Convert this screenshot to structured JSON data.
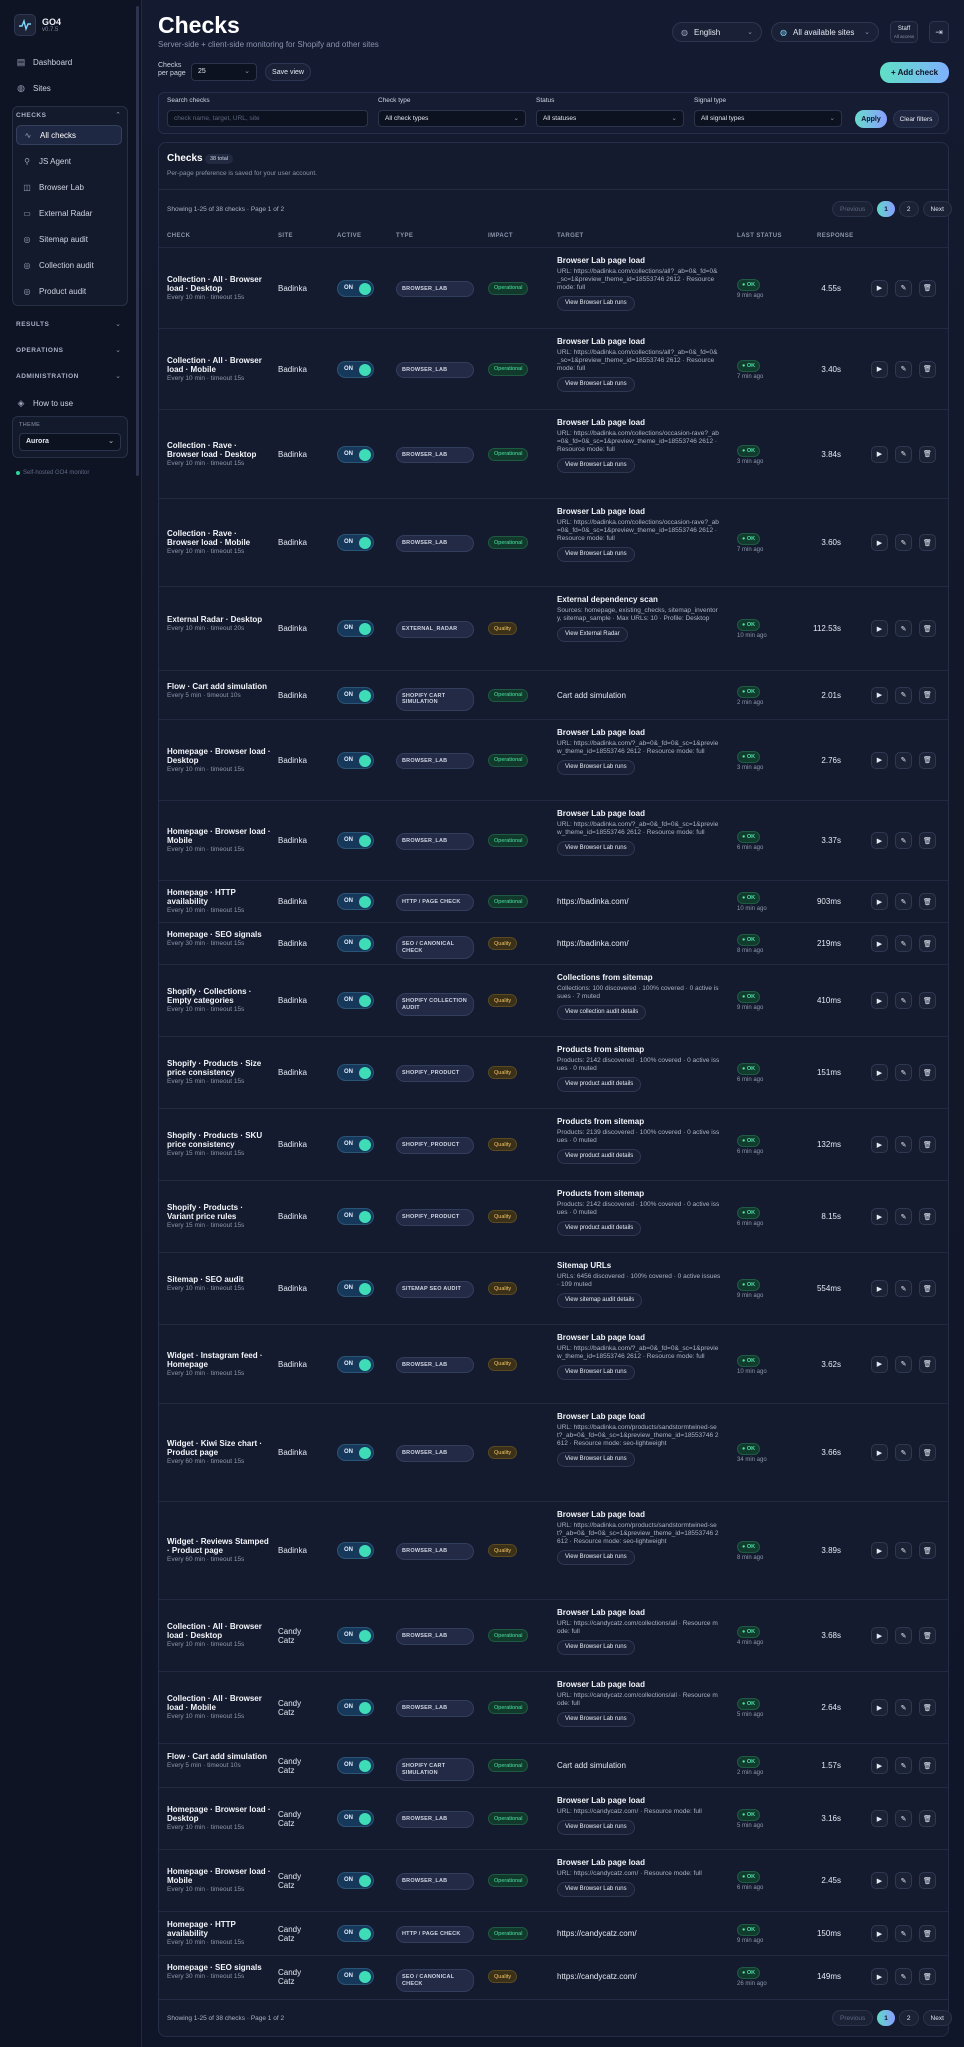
{
  "app": {
    "name": "GO4",
    "version": "v0.7.5"
  },
  "sidebar": {
    "top_items": [
      {
        "label": "Dashboard",
        "icon": "dashboard-icon"
      },
      {
        "label": "Sites",
        "icon": "globe-icon"
      }
    ],
    "checks_group": "CHECKS",
    "checks_items": [
      {
        "label": "All checks",
        "icon": "pulse-icon",
        "active": true
      },
      {
        "label": "JS Agent",
        "icon": "agent-icon"
      },
      {
        "label": "Browser Lab",
        "icon": "browser-icon"
      },
      {
        "label": "External Radar",
        "icon": "radar-icon"
      },
      {
        "label": "Sitemap audit",
        "icon": "sitemap-icon"
      },
      {
        "label": "Collection audit",
        "icon": "collection-icon"
      },
      {
        "label": "Product audit",
        "icon": "product-icon"
      }
    ],
    "groups": [
      "RESULTS",
      "OPERATIONS",
      "ADMINISTRATION"
    ],
    "how_to_use": "How to use",
    "theme_label": "THEME",
    "theme_value": "Aurora",
    "footer": "Self-hosted GO4 monitor"
  },
  "header": {
    "title": "Checks",
    "subtitle": "Server-side + client-side monitoring for Shopify and other sites",
    "language": "English",
    "sites_filter": "All available sites",
    "staff_label": "Staff",
    "staff_sub": "All access"
  },
  "toolbar": {
    "per_page_label": "Checks per page",
    "per_page_value": "25",
    "save_view": "Save view",
    "add_check": "+ Add check"
  },
  "filters": {
    "search_label": "Search checks",
    "search_placeholder": "check name, target, URL, site",
    "type_label": "Check type",
    "type_value": "All check types",
    "status_label": "Status",
    "status_value": "All statuses",
    "signal_label": "Signal type",
    "signal_value": "All signal types",
    "apply": "Apply",
    "clear": "Clear filters"
  },
  "list": {
    "title": "Checks",
    "total_badge": "38 total",
    "note": "Per-page preference is saved for your user account.",
    "showing": "Showing 1-25 of 38 checks · Page 1 of 2",
    "pager": {
      "previous": "Previous",
      "p1": "1",
      "p2": "2",
      "next": "Next"
    },
    "columns": [
      "CHECK",
      "SITE",
      "ACTIVE",
      "TYPE",
      "IMPACT",
      "TARGET",
      "LAST STATUS",
      "RESPONSE"
    ],
    "rows": [
      {
        "name": "Collection · All · Browser load · Desktop",
        "sched": "Every 10 min · timeout 15s",
        "site": "Badinka",
        "active": "ON",
        "type": "BROWSER_LAB",
        "impact": "Operational",
        "target_title": "Browser Lab page load",
        "target_detail": "URL: https://badinka.com/collections/all?_ab=0&_fd=0&_sc=1&preview_theme_id=18553746 2612 · Resource mode: full",
        "target_btn": "View Browser Lab runs",
        "status": "OK",
        "ago": "9 min ago",
        "resp": "4.55s"
      },
      {
        "name": "Collection · All · Browser load · Mobile",
        "sched": "Every 10 min · timeout 15s",
        "site": "Badinka",
        "active": "ON",
        "type": "BROWSER_LAB",
        "impact": "Operational",
        "target_title": "Browser Lab page load",
        "target_detail": "URL: https://badinka.com/collections/all?_ab=0&_fd=0&_sc=1&preview_theme_id=18553746 2612 · Resource mode: full",
        "target_btn": "View Browser Lab runs",
        "status": "OK",
        "ago": "7 min ago",
        "resp": "3.40s"
      },
      {
        "name": "Collection · Rave · Browser load · Desktop",
        "sched": "Every 10 min · timeout 15s",
        "site": "Badinka",
        "active": "ON",
        "type": "BROWSER_LAB",
        "impact": "Operational",
        "target_title": "Browser Lab page load",
        "target_detail": "URL: https://badinka.com/collections/occasion-rave?_ab=0&_fd=0&_sc=1&preview_theme_id=18553746 2612 · Resource mode: full",
        "target_btn": "View Browser Lab runs",
        "status": "OK",
        "ago": "3 min ago",
        "resp": "3.84s"
      },
      {
        "name": "Collection · Rave · Browser load · Mobile",
        "sched": "Every 10 min · timeout 15s",
        "site": "Badinka",
        "active": "ON",
        "type": "BROWSER_LAB",
        "impact": "Operational",
        "target_title": "Browser Lab page load",
        "target_detail": "URL: https://badinka.com/collections/occasion-rave?_ab=0&_fd=0&_sc=1&preview_theme_id=18553746 2612 · Resource mode: full",
        "target_btn": "View Browser Lab runs",
        "status": "OK",
        "ago": "7 min ago",
        "resp": "3.60s"
      },
      {
        "name": "External Radar · Desktop",
        "sched": "Every 10 min · timeout 20s",
        "site": "Badinka",
        "active": "ON",
        "type": "EXTERNAL_RADAR",
        "impact": "Quality",
        "target_title": "External dependency scan",
        "target_detail": "Sources: homepage, existing_checks, sitemap_inventory, sitemap_sample · Max URLs: 10 · Profile: Desktop",
        "target_btn": "View External Radar",
        "status": "OK",
        "ago": "10 min ago",
        "resp": "112.53s"
      },
      {
        "name": "Flow · Cart add simulation",
        "sched": "Every 5 min · timeout 10s",
        "site": "Badinka",
        "active": "ON",
        "type": "SHOPIFY CART SIMULATION",
        "impact": "Operational",
        "target_plain": "Cart add simulation",
        "status": "OK",
        "ago": "2 min ago",
        "resp": "2.01s"
      },
      {
        "name": "Homepage · Browser load · Desktop",
        "sched": "Every 10 min · timeout 15s",
        "site": "Badinka",
        "active": "ON",
        "type": "BROWSER_LAB",
        "impact": "Operational",
        "target_title": "Browser Lab page load",
        "target_detail": "URL: https://badinka.com/?_ab=0&_fd=0&_sc=1&preview_theme_id=18553746 2612 · Resource mode: full",
        "target_btn": "View Browser Lab runs",
        "status": "OK",
        "ago": "3 min ago",
        "resp": "2.76s"
      },
      {
        "name": "Homepage · Browser load · Mobile",
        "sched": "Every 10 min · timeout 15s",
        "site": "Badinka",
        "active": "ON",
        "type": "BROWSER_LAB",
        "impact": "Operational",
        "target_title": "Browser Lab page load",
        "target_detail": "URL: https://badinka.com/?_ab=0&_fd=0&_sc=1&preview_theme_id=18553746 2612 · Resource mode: full",
        "target_btn": "View Browser Lab runs",
        "status": "OK",
        "ago": "6 min ago",
        "resp": "3.37s"
      },
      {
        "name": "Homepage · HTTP availability",
        "sched": "Every 10 min · timeout 15s",
        "site": "Badinka",
        "active": "ON",
        "type": "HTTP / PAGE CHECK",
        "impact": "Operational",
        "target_plain": "https://badinka.com/",
        "status": "OK",
        "ago": "10 min ago",
        "resp": "903ms"
      },
      {
        "name": "Homepage · SEO signals",
        "sched": "Every 30 min · timeout 15s",
        "site": "Badinka",
        "active": "ON",
        "type": "SEO / CANONICAL CHECK",
        "impact": "Quality",
        "target_plain": "https://badinka.com/",
        "status": "OK",
        "ago": "8 min ago",
        "resp": "219ms"
      },
      {
        "name": "Shopify · Collections · Empty categories",
        "sched": "Every 10 min · timeout 15s",
        "site": "Badinka",
        "active": "ON",
        "type": "SHOPIFY COLLECTION AUDIT",
        "impact": "Quality",
        "target_title": "Collections from sitemap",
        "target_detail": "Collections: 100 discovered · 100% covered · 0 active issues · 7 muted",
        "target_btn": "View collection audit details",
        "status": "OK",
        "ago": "9 min ago",
        "resp": "410ms"
      },
      {
        "name": "Shopify · Products · Size price consistency",
        "sched": "Every 15 min · timeout 15s",
        "site": "Badinka",
        "active": "ON",
        "type": "SHOPIFY_PRODUCT",
        "impact": "Quality",
        "target_title": "Products from sitemap",
        "target_detail": "Products: 2142 discovered · 100% covered · 0 active issues · 0 muted",
        "target_btn": "View product audit details",
        "status": "OK",
        "ago": "6 min ago",
        "resp": "151ms"
      },
      {
        "name": "Shopify · Products · SKU price consistency",
        "sched": "Every 15 min · timeout 15s",
        "site": "Badinka",
        "active": "ON",
        "type": "SHOPIFY_PRODUCT",
        "impact": "Quality",
        "target_title": "Products from sitemap",
        "target_detail": "Products: 2139 discovered · 100% covered · 0 active issues · 0 muted",
        "target_btn": "View product audit details",
        "status": "OK",
        "ago": "6 min ago",
        "resp": "132ms"
      },
      {
        "name": "Shopify · Products · Variant price rules",
        "sched": "Every 15 min · timeout 15s",
        "site": "Badinka",
        "active": "ON",
        "type": "SHOPIFY_PRODUCT",
        "impact": "Quality",
        "target_title": "Products from sitemap",
        "target_detail": "Products: 2142 discovered · 100% covered · 0 active issues · 0 muted",
        "target_btn": "View product audit details",
        "status": "OK",
        "ago": "6 min ago",
        "resp": "8.15s"
      },
      {
        "name": "Sitemap · SEO audit",
        "sched": "Every 10 min · timeout 15s",
        "site": "Badinka",
        "active": "ON",
        "type": "SITEMAP SEO AUDIT",
        "impact": "Quality",
        "target_title": "Sitemap URLs",
        "target_detail": "URLs: 6456 discovered · 100% covered · 0 active issues · 109 muted",
        "target_btn": "View sitemap audit details",
        "status": "OK",
        "ago": "9 min ago",
        "resp": "554ms"
      },
      {
        "name": "Widget · Instagram feed · Homepage",
        "sched": "Every 10 min · timeout 15s",
        "site": "Badinka",
        "active": "ON",
        "type": "BROWSER_LAB",
        "impact": "Quality",
        "target_title": "Browser Lab page load",
        "target_detail": "URL: https://badinka.com/?_ab=0&_fd=0&_sc=1&preview_theme_id=18553746 2612 · Resource mode: full",
        "target_btn": "View Browser Lab runs",
        "status": "OK",
        "ago": "10 min ago",
        "resp": "3.62s"
      },
      {
        "name": "Widget · Kiwi Size chart · Product page",
        "sched": "Every 60 min · timeout 15s",
        "site": "Badinka",
        "active": "ON",
        "type": "BROWSER_LAB",
        "impact": "Quality",
        "target_title": "Browser Lab page load",
        "target_detail": "URL: https://badinka.com/products/sandstormtwined-set?_ab=0&_fd=0&_sc=1&preview_theme_id=18553746 2612 · Resource mode: seo-lightweight",
        "target_btn": "View Browser Lab runs",
        "status": "OK",
        "ago": "34 min ago",
        "resp": "3.66s"
      },
      {
        "name": "Widget · Reviews Stamped · Product page",
        "sched": "Every 60 min · timeout 15s",
        "site": "Badinka",
        "active": "ON",
        "type": "BROWSER_LAB",
        "impact": "Quality",
        "target_title": "Browser Lab page load",
        "target_detail": "URL: https://badinka.com/products/sandstormtwined-set?_ab=0&_fd=0&_sc=1&preview_theme_id=18553746 2612 · Resource mode: seo-lightweight",
        "target_btn": "View Browser Lab runs",
        "status": "OK",
        "ago": "8 min ago",
        "resp": "3.89s"
      },
      {
        "name": "Collection · All · Browser load · Desktop",
        "sched": "Every 10 min · timeout 15s",
        "site": "Candy Catz",
        "active": "ON",
        "type": "BROWSER_LAB",
        "impact": "Operational",
        "target_title": "Browser Lab page load",
        "target_detail": "URL: https://candycatz.com/collections/all · Resource mode: full",
        "target_btn": "View Browser Lab runs",
        "status": "OK",
        "ago": "4 min ago",
        "resp": "3.68s"
      },
      {
        "name": "Collection · All · Browser load · Mobile",
        "sched": "Every 10 min · timeout 15s",
        "site": "Candy Catz",
        "active": "ON",
        "type": "BROWSER_LAB",
        "impact": "Operational",
        "target_title": "Browser Lab page load",
        "target_detail": "URL: https://candycatz.com/collections/all · Resource mode: full",
        "target_btn": "View Browser Lab runs",
        "status": "OK",
        "ago": "5 min ago",
        "resp": "2.64s"
      },
      {
        "name": "Flow · Cart add simulation",
        "sched": "Every 5 min · timeout 10s",
        "site": "Candy Catz",
        "active": "ON",
        "type": "SHOPIFY CART SIMULATION",
        "impact": "Operational",
        "target_plain": "Cart add simulation",
        "status": "OK",
        "ago": "2 min ago",
        "resp": "1.57s"
      },
      {
        "name": "Homepage · Browser load · Desktop",
        "sched": "Every 10 min · timeout 15s",
        "site": "Candy Catz",
        "active": "ON",
        "type": "BROWSER_LAB",
        "impact": "Operational",
        "target_title": "Browser Lab page load",
        "target_detail": "URL: https://candycatz.com/ · Resource mode: full",
        "target_btn": "View Browser Lab runs",
        "status": "OK",
        "ago": "5 min ago",
        "resp": "3.16s"
      },
      {
        "name": "Homepage · Browser load · Mobile",
        "sched": "Every 10 min · timeout 15s",
        "site": "Candy Catz",
        "active": "ON",
        "type": "BROWSER_LAB",
        "impact": "Operational",
        "target_title": "Browser Lab page load",
        "target_detail": "URL: https://candycatz.com/ · Resource mode: full",
        "target_btn": "View Browser Lab runs",
        "status": "OK",
        "ago": "6 min ago",
        "resp": "2.45s"
      },
      {
        "name": "Homepage · HTTP availability",
        "sched": "Every 10 min · timeout 15s",
        "site": "Candy Catz",
        "active": "ON",
        "type": "HTTP / PAGE CHECK",
        "impact": "Operational",
        "target_plain": "https://candycatz.com/",
        "status": "OK",
        "ago": "9 min ago",
        "resp": "150ms"
      },
      {
        "name": "Homepage · SEO signals",
        "sched": "Every 30 min · timeout 15s",
        "site": "Candy Catz",
        "active": "ON",
        "type": "SEO / CANONICAL CHECK",
        "impact": "Quality",
        "target_plain": "https://candycatz.com/",
        "status": "OK",
        "ago": "26 min ago",
        "resp": "149ms"
      }
    ]
  }
}
